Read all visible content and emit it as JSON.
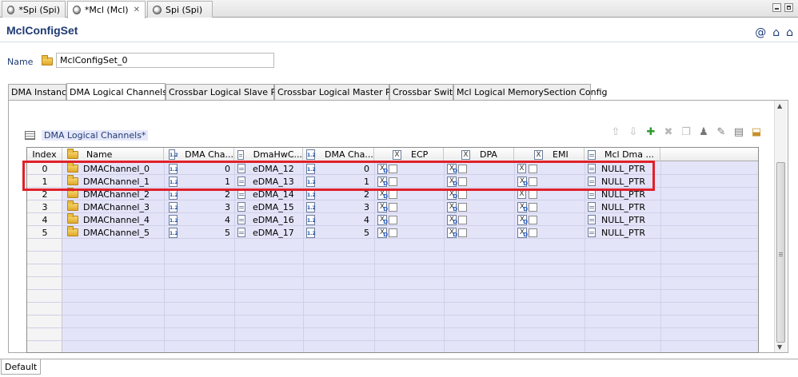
{
  "editor_tabs": [
    {
      "label": "*Spi (Spi)",
      "active": false,
      "closable": false
    },
    {
      "label": "*Mcl (Mcl)",
      "active": true,
      "closable": true
    },
    {
      "label": "Spi (Spi)",
      "active": false,
      "closable": false
    }
  ],
  "form": {
    "title": "MclConfigSet",
    "name_label": "Name",
    "name_value": "MclConfigSet_0"
  },
  "sub_tabs": [
    {
      "label": "DMA Instance"
    },
    {
      "label": "DMA Logical Channels",
      "active": true
    },
    {
      "label": "Crossbar Logical Slave Ports"
    },
    {
      "label": "Crossbar Logical Master Ports"
    },
    {
      "label": "Crossbar Switch"
    },
    {
      "label": "Mcl Logical MemorySection Config"
    }
  ],
  "table": {
    "title": "DMA Logical Channels*",
    "columns": [
      "Index",
      "Name",
      "DMA Cha...",
      "DmaHwC...",
      "DMA Cha...",
      "ECP",
      "DPA",
      "EMI",
      "Mcl Dma ..."
    ],
    "rows": [
      {
        "index": "0",
        "name": "DMAChannel_0",
        "dma_ch": "0",
        "hw": "eDMA_12",
        "dma_ch2": "0",
        "ptr": "NULL_PTR"
      },
      {
        "index": "1",
        "name": "DMAChannel_1",
        "dma_ch": "1",
        "hw": "eDMA_13",
        "dma_ch2": "1",
        "ptr": "NULL_PTR"
      },
      {
        "index": "2",
        "name": "DMAChannel_2",
        "dma_ch": "2",
        "hw": "eDMA_14",
        "dma_ch2": "2",
        "ptr": "NULL_PTR"
      },
      {
        "index": "3",
        "name": "DMAChannel_3",
        "dma_ch": "3",
        "hw": "eDMA_15",
        "dma_ch2": "3",
        "ptr": "NULL_PTR"
      },
      {
        "index": "4",
        "name": "DMAChannel_4",
        "dma_ch": "4",
        "hw": "eDMA_16",
        "dma_ch2": "4",
        "ptr": "NULL_PTR"
      },
      {
        "index": "5",
        "name": "DMAChannel_5",
        "dma_ch": "5",
        "hw": "eDMA_17",
        "dma_ch2": "5",
        "ptr": "NULL_PTR"
      }
    ]
  },
  "icons": {
    "header": [
      "at-icon",
      "home-icon",
      "settings-icon"
    ],
    "toolbar": [
      "move-up-icon",
      "move-down-icon",
      "add-icon",
      "delete-icon",
      "copy-icon",
      "user-icon",
      "edit-icon",
      "properties-icon",
      "export-icon"
    ]
  },
  "colors": {
    "title": "#1f3a73",
    "grid_bg": "#e4e4f9",
    "highlight": "#e0202a",
    "add": "#2f9a2f"
  },
  "bottom_tab": {
    "label": "Default"
  }
}
